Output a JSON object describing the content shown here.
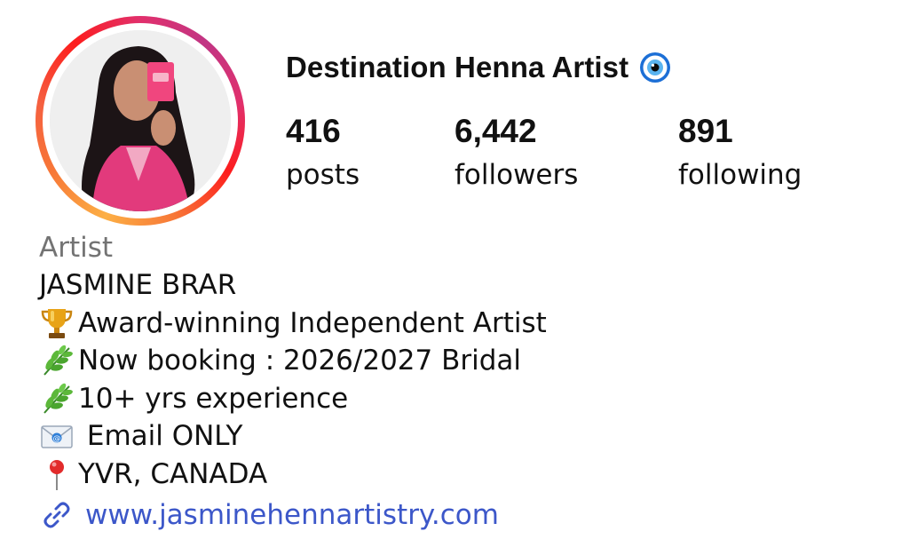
{
  "profile": {
    "display_name": "Destination Henna Artist",
    "verified_icon": "nazar-evil-eye-icon",
    "avatar": "profile-photo",
    "story_ring_colors": [
      "#fcaf45",
      "#f77737",
      "#fd1d1d",
      "#e1306c",
      "#c13584"
    ]
  },
  "stats": {
    "posts": {
      "count": "416",
      "label": "posts"
    },
    "followers": {
      "count": "6,442",
      "label": "followers"
    },
    "following": {
      "count": "891",
      "label": "following"
    }
  },
  "bio": {
    "category": "Artist",
    "name": "JASMINE BRAR",
    "lines": [
      {
        "icon": "trophy-icon",
        "text": "Award-winning Independent Artist"
      },
      {
        "icon": "herb-icon",
        "text": "Now booking : 2026/2027 Bridal"
      },
      {
        "icon": "herb-icon",
        "text": "10+ yrs experience"
      },
      {
        "icon": "envelope-icon",
        "text": " Email ONLY"
      },
      {
        "icon": "pin-icon",
        "text": "YVR, CANADA"
      }
    ],
    "link": {
      "icon": "link-icon",
      "text": "www.jasminehennartistry.com"
    }
  },
  "colors": {
    "text": "#111111",
    "category": "#737373",
    "link": "#3c57c9"
  }
}
